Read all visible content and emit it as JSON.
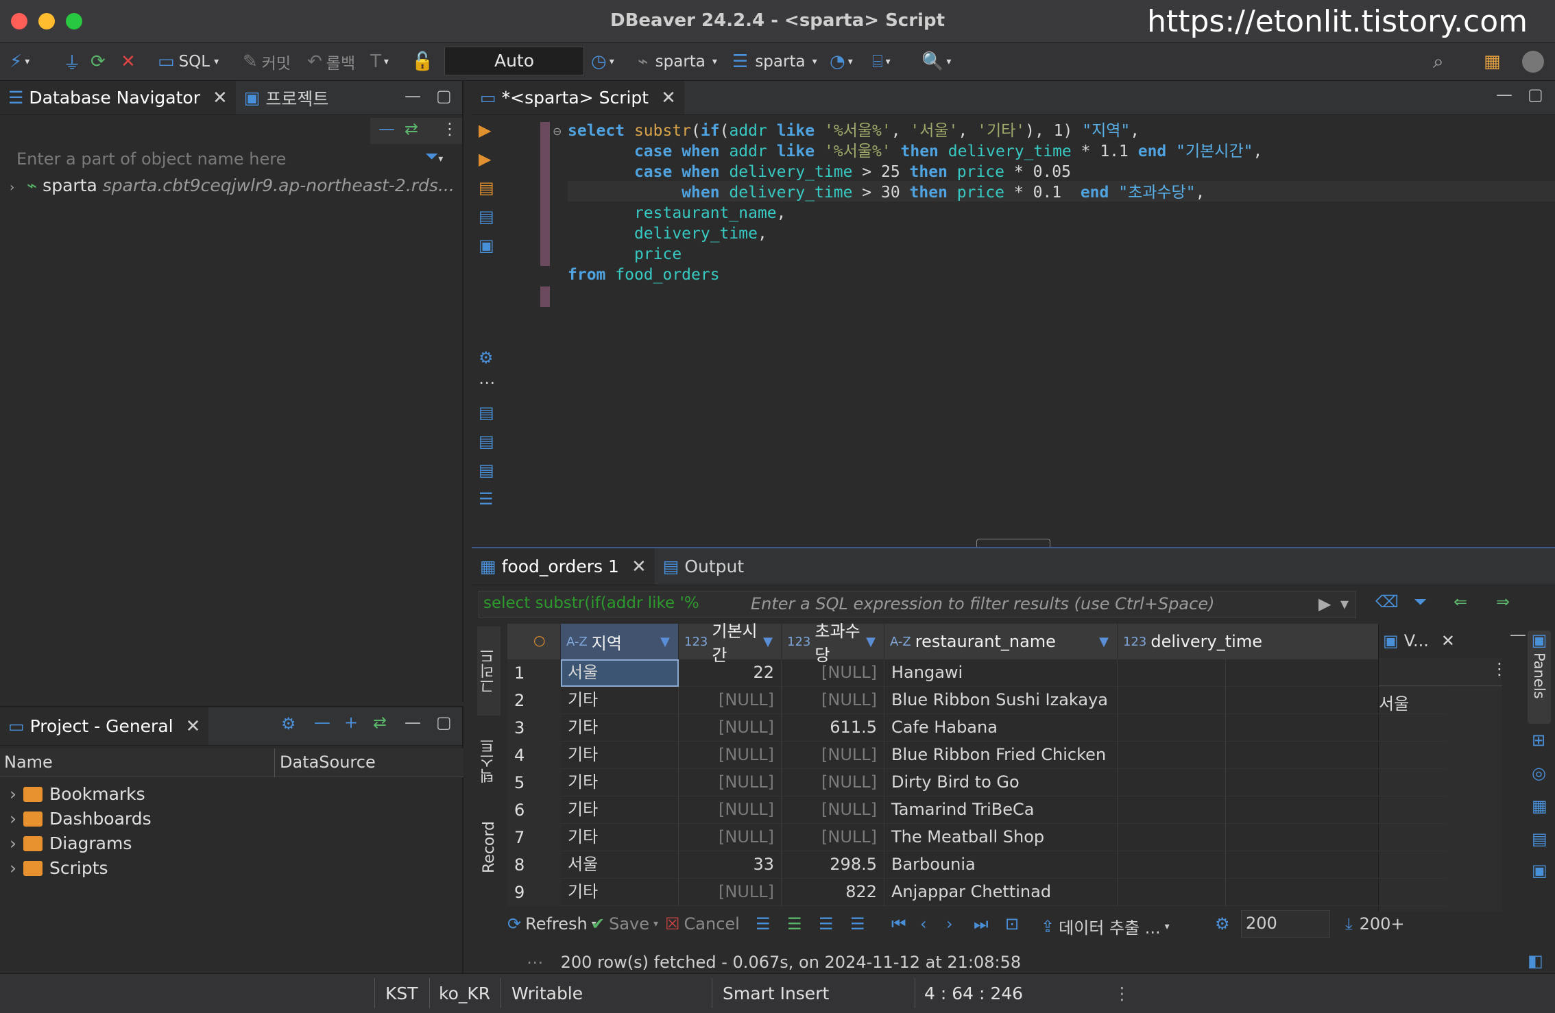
{
  "window": {
    "title": "DBeaver 24.2.4 - <sparta> Script",
    "watermark": "https://etonlit.tistory.com",
    "traffic_colors": [
      "#ff5f57",
      "#febc2e",
      "#28c840"
    ]
  },
  "toolbar": {
    "sql_label": "SQL",
    "commit_label": "커밋",
    "rollback_label": "롤백",
    "transaction_mode": "Auto",
    "connection": "sparta",
    "schema": "sparta"
  },
  "navigator": {
    "tab_label": "Database Navigator",
    "project_tab_label": "프로젝트",
    "filter_placeholder": "Enter a part of object name here",
    "connection_name": "sparta",
    "connection_detail": "sparta.cbt9ceqjwlr9.ap-northeast-2.rds..."
  },
  "project": {
    "tab_label": "Project - General",
    "col_name": "Name",
    "col_datasource": "DataSource",
    "items": [
      "Bookmarks",
      "Dashboards",
      "Diagrams",
      "Scripts"
    ]
  },
  "editor": {
    "tab_label": "*<sparta> Script"
  },
  "results": {
    "tab_label": "food_orders 1",
    "output_tab_label": "Output",
    "query_preview": "select substr(if(addr like '%",
    "filter_placeholder": "Enter a SQL expression to filter results (use Ctrl+Space)",
    "side_tabs": [
      "그리드",
      "텍스트",
      "Record"
    ],
    "columns": [
      {
        "type": "A-Z",
        "name": "지역"
      },
      {
        "type": "123",
        "name": "기본시간"
      },
      {
        "type": "123",
        "name": "초과수당"
      },
      {
        "type": "A-Z",
        "name": "restaurant_name"
      },
      {
        "type": "123",
        "name": "delivery_time"
      }
    ],
    "rows": [
      {
        "n": "1",
        "c0": "서울",
        "c1": "22",
        "c2": "[NULL]",
        "c3": "Hangawi"
      },
      {
        "n": "2",
        "c0": "기타",
        "c1": "[NULL]",
        "c2": "[NULL]",
        "c3": "Blue Ribbon Sushi Izakaya"
      },
      {
        "n": "3",
        "c0": "기타",
        "c1": "[NULL]",
        "c2": "611.5",
        "c3": "Cafe Habana"
      },
      {
        "n": "4",
        "c0": "기타",
        "c1": "[NULL]",
        "c2": "[NULL]",
        "c3": "Blue Ribbon Fried Chicken"
      },
      {
        "n": "5",
        "c0": "기타",
        "c1": "[NULL]",
        "c2": "[NULL]",
        "c3": "Dirty Bird to Go"
      },
      {
        "n": "6",
        "c0": "기타",
        "c1": "[NULL]",
        "c2": "[NULL]",
        "c3": "Tamarind TriBeCa"
      },
      {
        "n": "7",
        "c0": "기타",
        "c1": "[NULL]",
        "c2": "[NULL]",
        "c3": "The Meatball Shop"
      },
      {
        "n": "8",
        "c0": "서울",
        "c1": "33",
        "c2": "298.5",
        "c3": "Barbounia"
      },
      {
        "n": "9",
        "c0": "기타",
        "c1": "[NULL]",
        "c2": "822",
        "c3": "Anjappar Chettinad"
      }
    ],
    "value_panel_tab": "V...",
    "value_panel_value": "서울",
    "panels_label": "Panels",
    "refresh_label": "Refresh",
    "save_label": "Save",
    "cancel_label": "Cancel",
    "export_label": "데이터 추출 ...",
    "fetch_size": "200",
    "fetch_all": "200+",
    "status_message": "200 row(s) fetched - 0.067s, on 2024-11-12 at 21:08:58"
  },
  "statusbar": {
    "timezone": "KST",
    "locale": "ko_KR",
    "mode": "Writable",
    "insert_mode": "Smart Insert",
    "position": "4 : 64 : 246"
  }
}
